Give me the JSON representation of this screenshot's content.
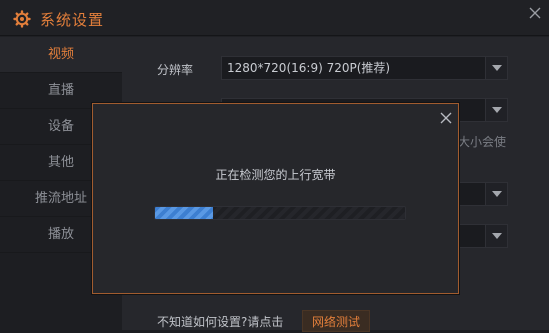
{
  "title": "系统设置",
  "sidebar": {
    "items": [
      {
        "label": "视频",
        "active": true
      },
      {
        "label": "直播"
      },
      {
        "label": "设备"
      },
      {
        "label": "其他"
      },
      {
        "label": "推流地址"
      },
      {
        "label": "播放"
      }
    ]
  },
  "settings": {
    "resolution_label": "分辨率",
    "resolution_value": "1280*720(16:9) 720P(推荐)",
    "hint": "大小会使"
  },
  "footer": {
    "help_text": "不知道如何设置?请点击",
    "network_test_button": "网络测试"
  },
  "modal": {
    "message": "正在检测您的上行宽带",
    "progress": 0.23
  },
  "colors": {
    "accent": "#e37f3b",
    "progress": "#4a8ddb"
  },
  "icons": [
    "gear-icon",
    "close-icon",
    "chevron-down-icon"
  ]
}
